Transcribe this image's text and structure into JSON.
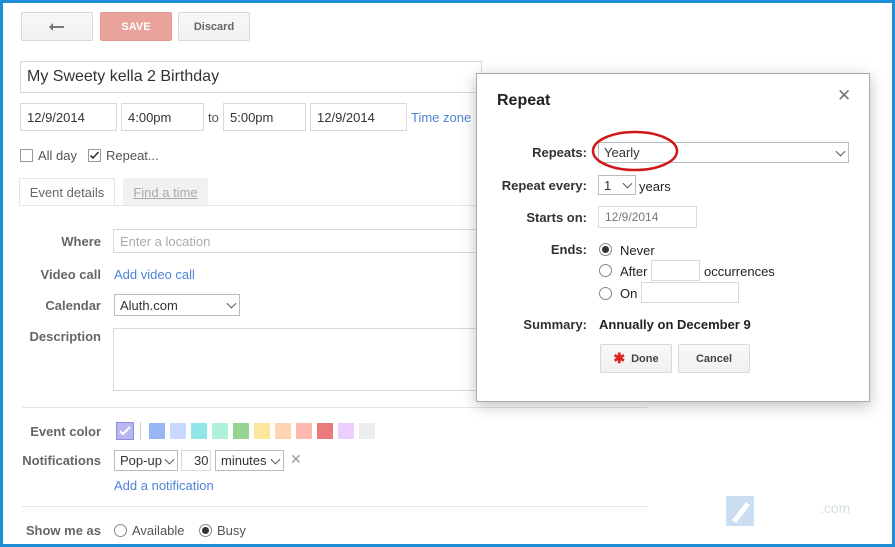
{
  "toolbar": {
    "back_icon": "back-arrow-icon",
    "save_label": "SAVE",
    "discard_label": "Discard"
  },
  "event": {
    "title": "My Sweety kella 2 Birthday",
    "start_date": "12/9/2014",
    "start_time": "4:00pm",
    "to_label": "to",
    "end_time": "5:00pm",
    "end_date": "12/9/2014",
    "time_zone_label": "Time zone",
    "all_day_label": "All day",
    "repeat_label": "Repeat..."
  },
  "tabs": {
    "event_details": "Event details",
    "find_a_time": "Find a time"
  },
  "details": {
    "where_label": "Where",
    "where_placeholder": "Enter a location",
    "video_call_label": "Video call",
    "add_video_call": "Add video call",
    "calendar_label": "Calendar",
    "calendar_value": "Aluth.com",
    "description_label": "Description",
    "event_color_label": "Event color",
    "colors": [
      "#a4bdfc",
      "#7ae7bf",
      "#dbadff",
      "#ff887c",
      "#fbd75b",
      "#ffb878",
      "#46d6db",
      "#e1e1e1",
      "#5484ed",
      "#51b749",
      "#dc2127"
    ],
    "notifications_label": "Notifications",
    "notification_type": "Pop-up",
    "notification_amount": "30",
    "notification_unit": "minutes",
    "add_notification": "Add a notification",
    "show_me_as_label": "Show me as",
    "available_label": "Available",
    "busy_label": "Busy"
  },
  "dialog": {
    "title": "Repeat",
    "repeats_label": "Repeats:",
    "repeats_value": "Yearly",
    "repeat_every_label": "Repeat every:",
    "repeat_every_value": "1",
    "repeat_every_unit": "years",
    "starts_on_label": "Starts on:",
    "starts_on_value": "12/9/2014",
    "ends_label": "Ends:",
    "never_label": "Never",
    "after_label": "After",
    "occurrences_label": "occurrences",
    "on_label": "On",
    "summary_label": "Summary:",
    "summary_value": "Annually on December 9",
    "done_label": "Done",
    "cancel_label": "Cancel"
  },
  "watermark": ".com"
}
